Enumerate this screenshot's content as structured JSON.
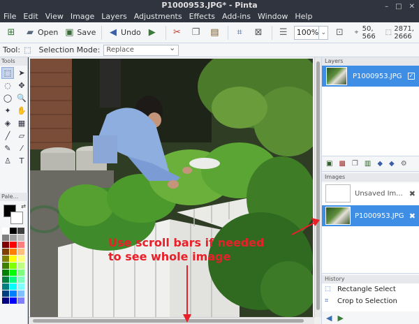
{
  "window": {
    "title": "P1000953.JPG* - Pinta",
    "controls": [
      "–",
      "□",
      "✕"
    ]
  },
  "menu": [
    "File",
    "Edit",
    "View",
    "Image",
    "Layers",
    "Adjustments",
    "Effects",
    "Add-ins",
    "Window",
    "Help"
  ],
  "toolbar": {
    "open_label": "Open",
    "save_label": "Save",
    "undo_label": "Undo",
    "zoom_value": "100%",
    "cursor_position": "50, 566",
    "selection_size": "2871, 2666"
  },
  "tool_options": {
    "tool_label": "Tool:",
    "mode_label": "Selection Mode:",
    "mode_value": "Replace"
  },
  "panels": {
    "tools_header": "Tools",
    "palette_header": "Pale..."
  },
  "tools": [
    {
      "icon": "rectangle-select-icon",
      "glyph": "⬚",
      "active": true
    },
    {
      "icon": "move-selected-icon",
      "glyph": "➤",
      "active": false
    },
    {
      "icon": "lasso-select-icon",
      "glyph": "◌",
      "active": false
    },
    {
      "icon": "move-selection-icon",
      "glyph": "✥",
      "active": false
    },
    {
      "icon": "ellipse-select-icon",
      "glyph": "◯",
      "active": false
    },
    {
      "icon": "zoom-icon",
      "glyph": "🔍",
      "active": false
    },
    {
      "icon": "magic-wand-icon",
      "glyph": "✦",
      "active": false
    },
    {
      "icon": "pan-icon",
      "glyph": "✋",
      "active": false
    },
    {
      "icon": "paint-bucket-icon",
      "glyph": "◈",
      "active": false
    },
    {
      "icon": "gradient-icon",
      "glyph": "▦",
      "active": false
    },
    {
      "icon": "paintbrush-icon",
      "glyph": "╱",
      "active": false
    },
    {
      "icon": "eraser-icon",
      "glyph": "▱",
      "active": false
    },
    {
      "icon": "pencil-icon",
      "glyph": "✎",
      "active": false
    },
    {
      "icon": "color-picker-icon",
      "glyph": "⁄",
      "active": false
    },
    {
      "icon": "clone-stamp-icon",
      "glyph": "♙",
      "active": false
    },
    {
      "icon": "text-icon",
      "glyph": "T",
      "active": false
    }
  ],
  "palette": {
    "primary": "#000000",
    "secondary": "#ffffff",
    "swatches": [
      "#ffffff",
      "#000000",
      "#404040",
      "#808080",
      "#a0a0a0",
      "#c0c0c0",
      "#7f0000",
      "#ff0000",
      "#ff7f7f",
      "#7f3f00",
      "#ff7f00",
      "#ffbf7f",
      "#7f7f00",
      "#ffff00",
      "#ffff7f",
      "#3f7f00",
      "#7fff00",
      "#bfff7f",
      "#007f00",
      "#00ff00",
      "#7fff7f",
      "#007f3f",
      "#00ff7f",
      "#7fffbf",
      "#007f7f",
      "#00ffff",
      "#7fffff",
      "#003f7f",
      "#007fff",
      "#7fbfff",
      "#00007f",
      "#0000ff",
      "#7f7fff"
    ]
  },
  "annotation": {
    "line1": "Use scroll bars if needed",
    "line2": "to see whole image"
  },
  "layers": {
    "header": "Layers",
    "items": [
      {
        "name": "P1000953.JPG",
        "visible": true
      }
    ]
  },
  "images": {
    "header": "Images",
    "items": [
      {
        "name": "Unsaved Im...",
        "selected": false
      },
      {
        "name": "P1000953.JPG",
        "selected": true
      }
    ]
  },
  "history": {
    "header": "History",
    "items": [
      "Rectangle Select",
      "Crop to Selection"
    ]
  },
  "accent_color": "#3d8ee4",
  "arrow_color": "#e8202a"
}
